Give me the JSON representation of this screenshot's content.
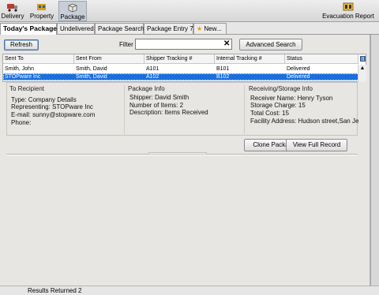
{
  "toolbar": {
    "items": [
      {
        "label": "Delivery",
        "icon": "delivery-truck-icon"
      },
      {
        "label": "Property",
        "icon": "property-icon"
      },
      {
        "label": "Package",
        "icon": "package-icon"
      }
    ],
    "evacuation_label": "Evacuation Report"
  },
  "tabs": [
    {
      "label": "Today's Packages",
      "active": true
    },
    {
      "label": "Undelivered"
    },
    {
      "label": "Package Search"
    },
    {
      "label": "Package Entry 7"
    },
    {
      "label": "New..."
    }
  ],
  "controls": {
    "refresh_label": "Refresh",
    "filter_label": "Filter",
    "filter_value": "",
    "filter_clear": "✕",
    "advanced_search_label": "Advanced Search"
  },
  "table": {
    "columns": [
      "Sent To",
      "Sent From",
      "Shipper Tracking #",
      "Internal Tracking #",
      "Status"
    ],
    "rows": [
      {
        "sent_to": "Smith, John",
        "sent_from": "Smith, David",
        "shipper": "A101",
        "internal": "B101",
        "status": "Delivered",
        "selected": false
      },
      {
        "sent_to": "STOPware Inc",
        "sent_from": "Smith, David",
        "shipper": "A102",
        "internal": "B102",
        "status": "Delivered",
        "selected": true
      }
    ]
  },
  "details": {
    "recipient": {
      "title": "To Recipient",
      "type": "Type: Company Details",
      "representing": "Representing: STOPware Inc",
      "email": "E-mail: sunny@stopware.com",
      "phone": "Phone:"
    },
    "package": {
      "title": "Package Info",
      "shipper": "Shipper: David Smith",
      "items": "Number of Items: 2",
      "description": "Description: Items Received"
    },
    "storage": {
      "title": "Receiving/Storage Info",
      "receiver": "Receiver Name: Henry Tyson",
      "charge": "Storage Charge: 15",
      "cost": "Total Cost: 15",
      "facility": "Facility Address: Hudson street,San Je"
    }
  },
  "actions": {
    "clone_label": "Clone Package",
    "view_label": "View Full Record"
  },
  "status": {
    "results": "Results Returned 2"
  }
}
